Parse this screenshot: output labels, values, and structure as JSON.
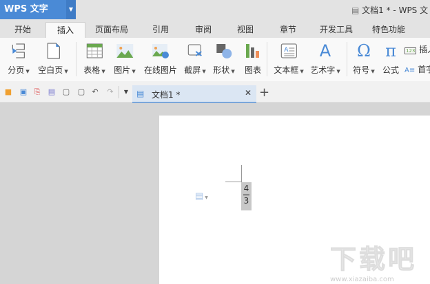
{
  "app": {
    "name": "WPS 文字",
    "window_title": "文档1 * - WPS 文"
  },
  "tabs": [
    "开始",
    "插入",
    "页面布局",
    "引用",
    "审阅",
    "视图",
    "章节",
    "开发工具",
    "特色功能"
  ],
  "active_tab": "插入",
  "ribbon": [
    {
      "label": "分页",
      "dropdown": true,
      "icon": "page-break-icon"
    },
    {
      "label": "空白页",
      "dropdown": true,
      "icon": "blank-page-icon"
    },
    {
      "label": "表格",
      "dropdown": true,
      "icon": "table-icon"
    },
    {
      "label": "图片",
      "dropdown": true,
      "icon": "picture-icon"
    },
    {
      "label": "在线图片",
      "dropdown": false,
      "icon": "online-picture-icon"
    },
    {
      "label": "截屏",
      "dropdown": true,
      "icon": "screenshot-icon"
    },
    {
      "label": "形状",
      "dropdown": true,
      "icon": "shapes-icon"
    },
    {
      "label": "图表",
      "dropdown": false,
      "icon": "chart-icon"
    },
    {
      "label": "文本框",
      "dropdown": true,
      "icon": "textbox-icon"
    },
    {
      "label": "艺术字",
      "dropdown": true,
      "icon": "wordart-icon"
    },
    {
      "label": "符号",
      "dropdown": true,
      "icon": "omega-icon"
    },
    {
      "label": "公式",
      "dropdown": false,
      "icon": "pi-icon"
    }
  ],
  "ribbon_small": [
    "插入",
    "首字"
  ],
  "doc_tab": {
    "title": "文档1 *"
  },
  "document": {
    "numerator": "4",
    "denominator": "3"
  },
  "watermark": {
    "text": "下载吧",
    "url": "www.xiazaiba.com"
  },
  "colors": {
    "accent": "#4a8ad6"
  }
}
